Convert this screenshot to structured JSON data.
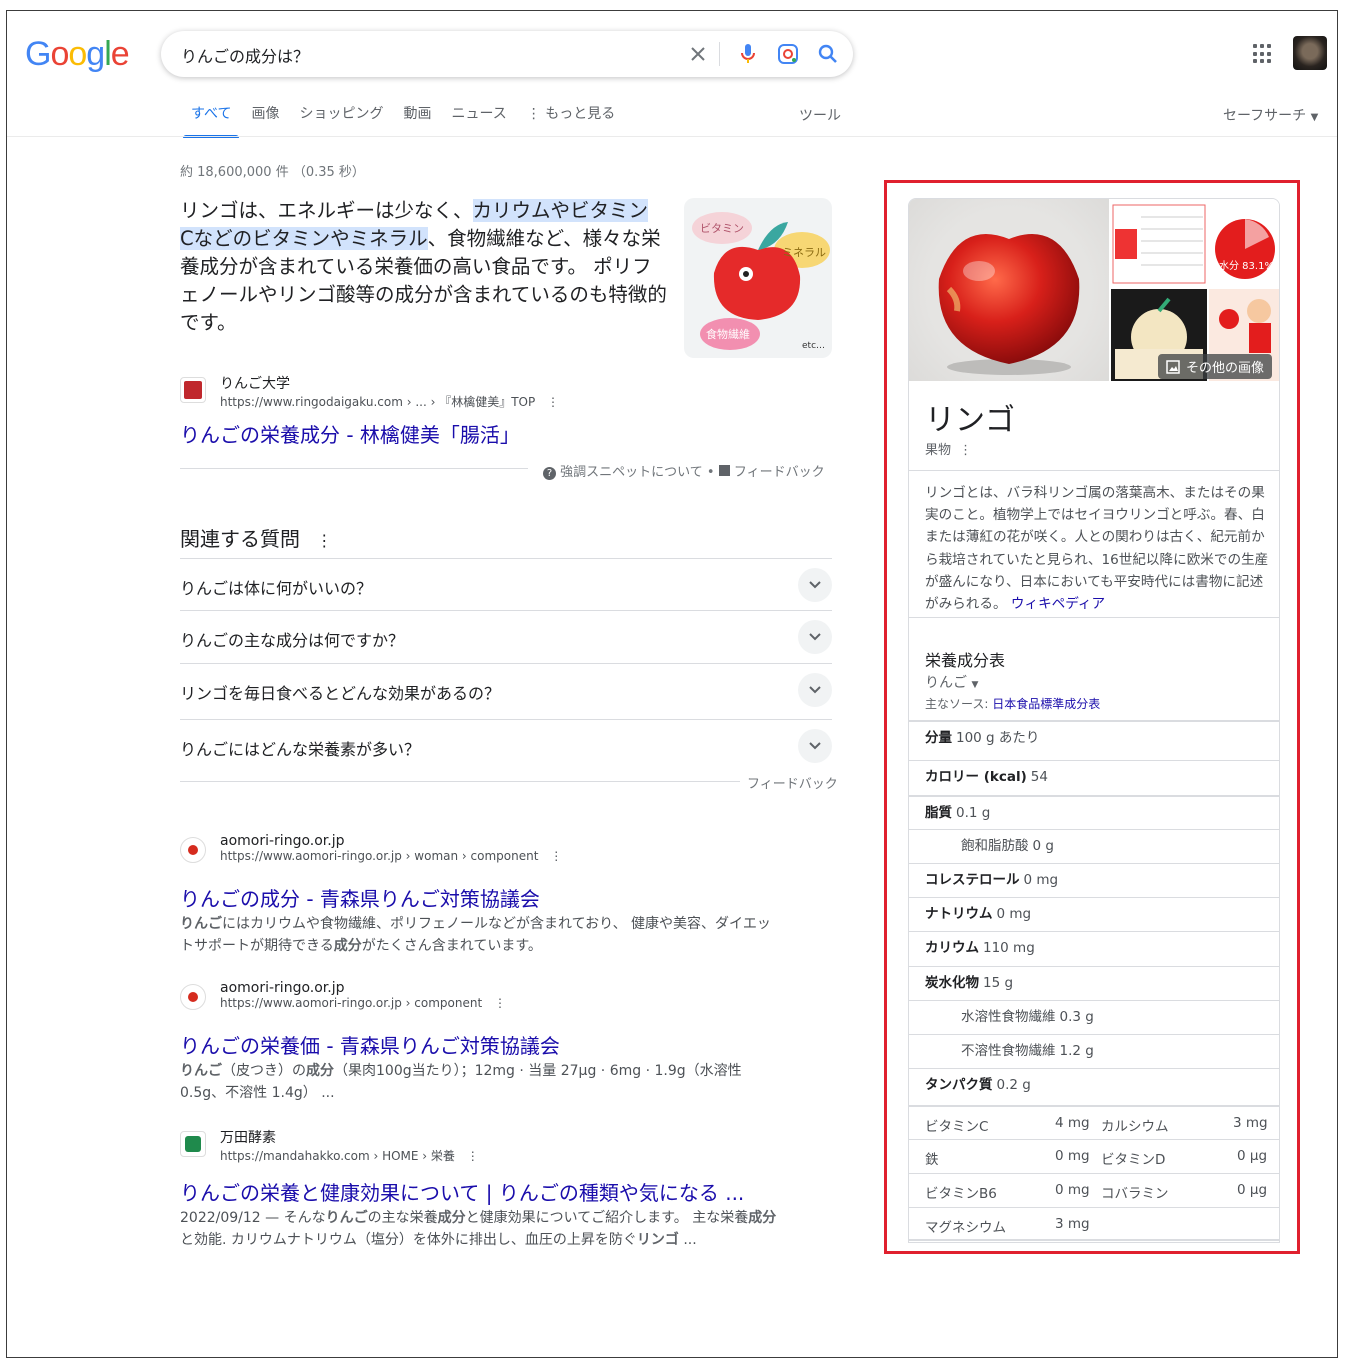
{
  "header": {
    "logo_text": "Google",
    "search_query": "りんごの成分は？",
    "tabs": [
      {
        "label": "すべて",
        "active": true
      },
      {
        "label": "画像"
      },
      {
        "label": "ショッピング"
      },
      {
        "label": "動画"
      },
      {
        "label": "ニュース"
      },
      {
        "label": "もっと見る"
      }
    ],
    "tools_label": "ツール",
    "safesearch_label": "セーフサーチ"
  },
  "stats": "約 18,600,000 件 （0.35 秒）",
  "featured_snippet": {
    "text_plain_1": "リンゴは、エネルギーは少なく、",
    "text_highlight_1": "カリウムやビタミン",
    "text_highlight_2": "Cなどのビタミンやミネラル",
    "text_plain_2": "、食物繊維など、様々な栄養成分が含まれている栄養価の高い食品です。 ポリフェノールやリンゴ酸等の成分が含まれているのも特徴的です。",
    "image_labels": {
      "a": "ビタミン",
      "b": "ミネラル",
      "c": "食物繊維",
      "d": "etc…"
    },
    "source_name": "りんご大学",
    "source_url": "https://www.ringodaigaku.com › ... › 『林檎健美』TOP",
    "source_title": "りんごの栄養成分 - 林檎健美「腸活」",
    "about_label": "強調スニペットについて",
    "feedback_label": "フィードバック"
  },
  "paa": {
    "title": "関連する質問",
    "questions": [
      "りんごは体に何がいいの？",
      "りんごの主な成分は何ですか？",
      "リンゴを毎日食べるとどんな効果があるの？",
      "りんごにはどんな栄養素が多い？"
    ],
    "feedback_label": "フィードバック"
  },
  "results": [
    {
      "site": "aomori-ringo.or.jp",
      "url": "https://www.aomori-ringo.or.jp › woman › component",
      "title": "りんごの成分 - 青森県りんご対策協議会",
      "snippet_b1": "りんご",
      "snippet_1": "にはカリウムや食物繊維、ポリフェノールなどが含まれており、 健康や美容、ダイエットサポートが期待できる",
      "snippet_b2": "成分",
      "snippet_2": "がたくさん含まれています。"
    },
    {
      "site": "aomori-ringo.or.jp",
      "url": "https://www.aomori-ringo.or.jp › component",
      "title": "りんごの栄養価 - 青森県りんご対策協議会",
      "snippet_b1": "りんご",
      "snippet_1": "（皮つき）の",
      "snippet_b2": "成分",
      "snippet_2": "（果肉100g当たり）；12mg · 当量 27μg · 6mg · 1.9g（水溶性 0.5g、不溶性 1.4g） ..."
    },
    {
      "site": "万田酵素",
      "url": "https://mandahakko.com › HOME › 栄養",
      "title": "りんごの栄養と健康効果について | りんごの種類や気になる ...",
      "snippet_1": "2022/09/12 — そんな",
      "snippet_b1": "りんご",
      "snippet_2": "の主な栄養",
      "snippet_b2": "成分",
      "snippet_3": "と健康効果についてご紹介します。 主な栄養",
      "snippet_b3": "成分",
      "snippet_4": "と効能. カリウムナトリウム（塩分）を体外に排出し、血圧の上昇を防ぐ",
      "snippet_b4": "リンゴ",
      "snippet_5": " ..."
    }
  ],
  "knowledge_panel": {
    "more_images_label": "その他の画像",
    "thumb_label_1": "水分 83.1%",
    "title": "リンゴ",
    "subtitle": "果物",
    "description": "リンゴとは、バラ科リンゴ属の落葉高木、またはその果実のこと。植物学上ではセイヨウリンゴと呼ぶ。春、白または薄紅の花が咲く。人との関わりは古く、紀元前から栽培されていたと見られ、16世紀以降に欧米での生産が盛んになり、日本においても平安時代には書物に記述がみられる。",
    "wiki_label": "ウィキペディア",
    "nutrition_title": "栄養成分表",
    "nutrition_item": "りんご",
    "source_prefix": "主なソース:",
    "source_link": "日本食品標準成分表",
    "rows": [
      {
        "label": "分量",
        "value": "100 g あたり"
      },
      {
        "label": "カロリー (kcal)",
        "value": "54"
      },
      {
        "label": "脂質",
        "value": "0.1 g"
      },
      {
        "label": "飽和脂肪酸",
        "value": "0 g"
      },
      {
        "label": "コレステロール",
        "value": "0 mg"
      },
      {
        "label": "ナトリウム",
        "value": "0 mg"
      },
      {
        "label": "カリウム",
        "value": "110 mg"
      },
      {
        "label": "炭水化物",
        "value": "15 g"
      },
      {
        "label": "水溶性食物繊維",
        "value": "0.3 g"
      },
      {
        "label": "不溶性食物繊維",
        "value": "1.2 g"
      },
      {
        "label": "タンパク質",
        "value": "0.2 g"
      }
    ],
    "vitamins": [
      {
        "l1": "ビタミンC",
        "v1": "4 mg",
        "l2": "カルシウム",
        "v2": "3 mg"
      },
      {
        "l1": "鉄",
        "v1": "0 mg",
        "l2": "ビタミンD",
        "v2": "0 μg"
      },
      {
        "l1": "ビタミンB6",
        "v1": "0 mg",
        "l2": "コバラミン",
        "v2": "0 μg"
      },
      {
        "l1": "マグネシウム",
        "v1": "3 mg",
        "l2": "",
        "v2": ""
      }
    ]
  },
  "colors": {
    "accent": "#1a73e8",
    "link": "#1a0dab",
    "highlight_box": "#e0202e"
  }
}
